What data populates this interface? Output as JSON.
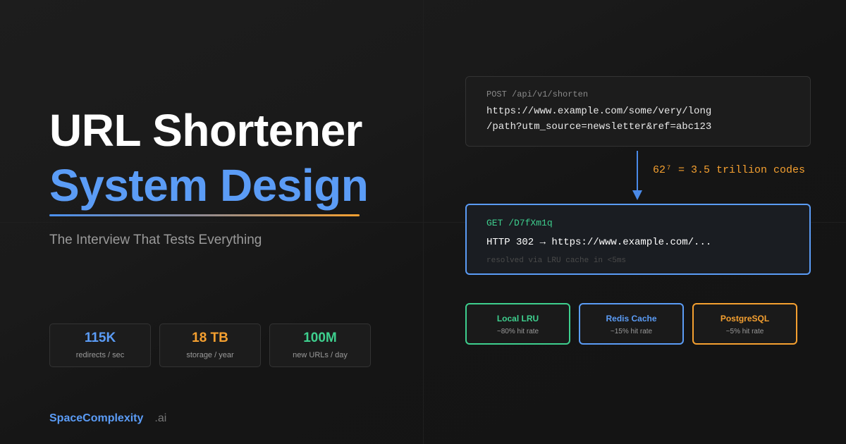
{
  "title": {
    "line1": "URL Shortener",
    "line2": "System Design"
  },
  "subtitle": "The Interview That Tests Everything",
  "stats": [
    {
      "value": "115K",
      "label": "redirects / sec",
      "color": "#5b9cf6"
    },
    {
      "value": "18 TB",
      "label": "storage / year",
      "color": "#f5a030"
    },
    {
      "value": "100M",
      "label": "new URLs / day",
      "color": "#3ecf8e"
    }
  ],
  "brand": {
    "name": "SpaceComplexity",
    "suffix": ".ai"
  },
  "request": {
    "method": "POST /api/v1/shorten",
    "url_line1": "https://www.example.com/some/very/long",
    "url_line2": "/path?utm_source=newsletter&ref=abc123"
  },
  "arrow_note": "62⁷ = 3.5 trillion codes",
  "response": {
    "get": "GET /D7fXm1q",
    "http": "HTTP 302 → https://www.example.com/...",
    "note": "resolved via LRU cache in <5ms"
  },
  "caches": [
    {
      "name": "Local LRU",
      "rate": "~80% hit rate",
      "color": "#3ecf8e"
    },
    {
      "name": "Redis Cache",
      "rate": "~15% hit rate",
      "color": "#5b9cf6"
    },
    {
      "name": "PostgreSQL",
      "rate": "~5% hit rate",
      "color": "#f5a030"
    }
  ],
  "colors": {
    "accent_blue": "#5b9cf6",
    "accent_orange": "#f5a030",
    "accent_green": "#3ecf8e",
    "background": "#161616"
  }
}
